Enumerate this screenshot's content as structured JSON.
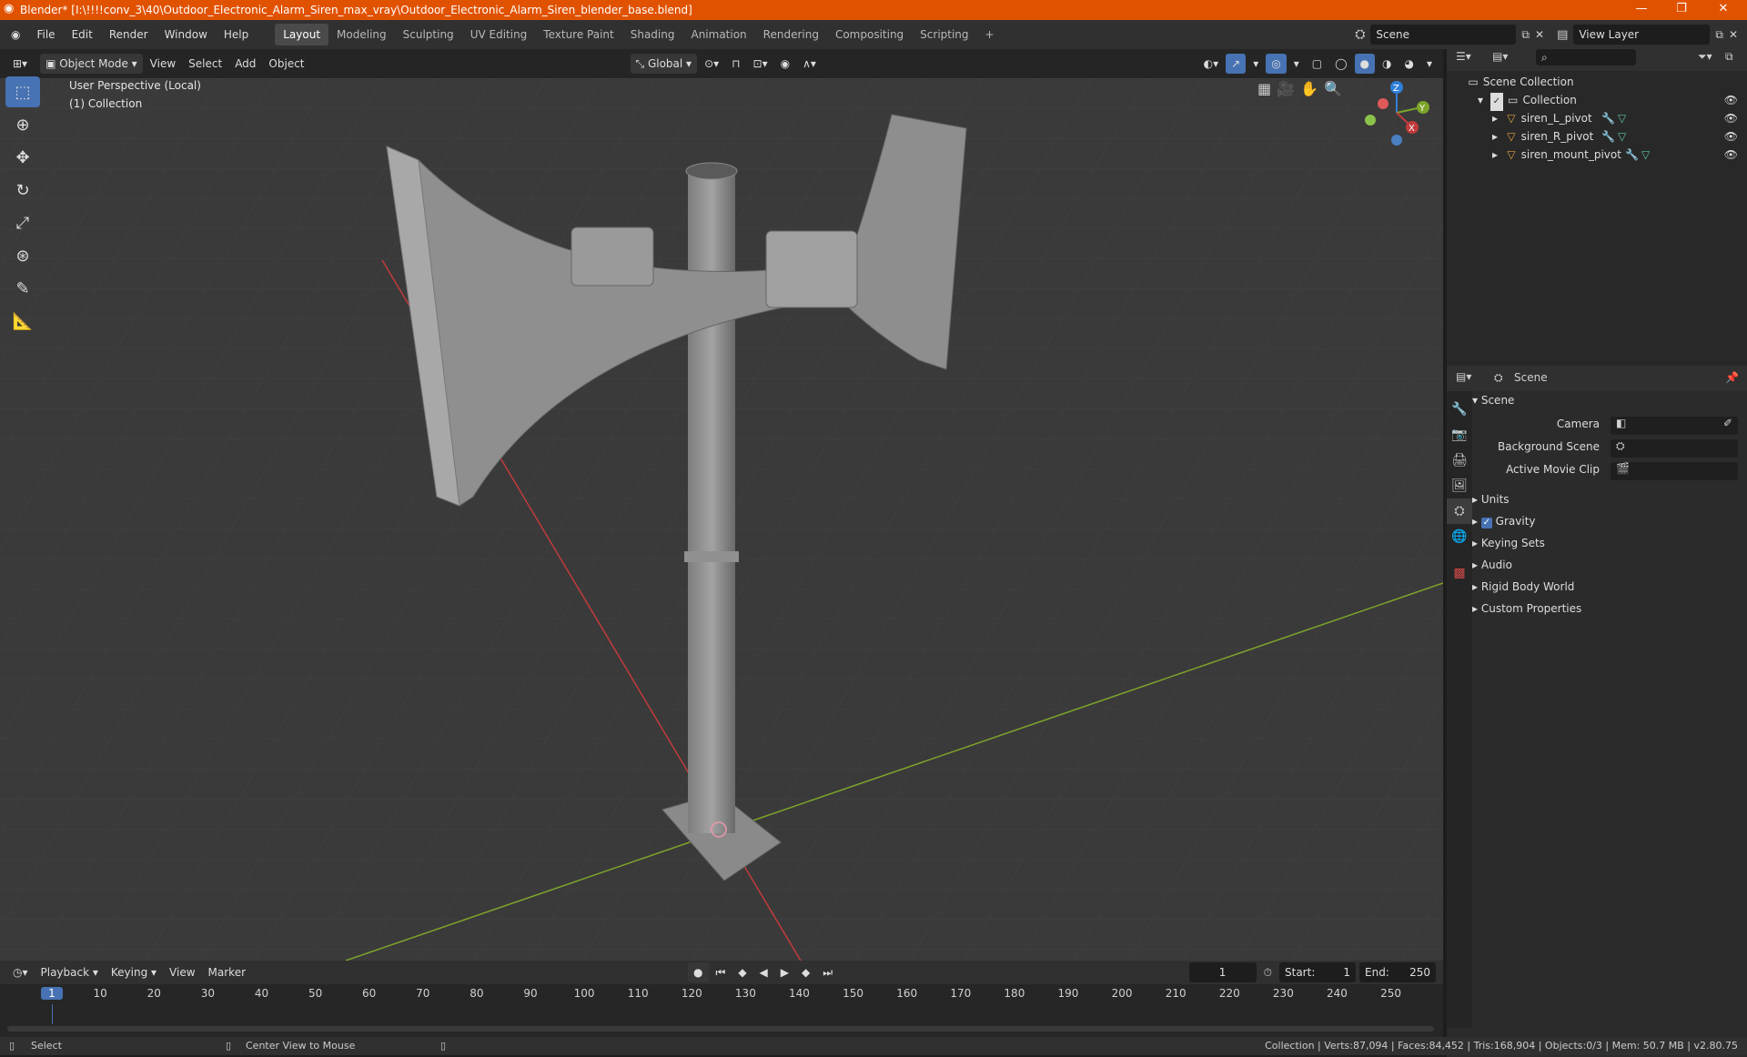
{
  "window": {
    "title": "Blender* [I:\\!!!!conv_3\\40\\Outdoor_Electronic_Alarm_Siren_max_vray\\Outdoor_Electronic_Alarm_Siren_blender_base.blend]",
    "controls": [
      "minimize-icon",
      "maximize-icon",
      "close-icon"
    ]
  },
  "menus": [
    "File",
    "Edit",
    "Render",
    "Window",
    "Help"
  ],
  "workspaces": [
    "Layout",
    "Modeling",
    "Sculpting",
    "UV Editing",
    "Texture Paint",
    "Shading",
    "Animation",
    "Rendering",
    "Compositing",
    "Scripting"
  ],
  "active_workspace": "Layout",
  "scene_selector": "Scene",
  "view_layer_selector": "View Layer",
  "viewport_header": {
    "mode": "Object Mode",
    "menus": [
      "View",
      "Select",
      "Add",
      "Object"
    ],
    "orientation": "Global"
  },
  "viewport_overlay": {
    "perspective": "User Perspective (Local)",
    "collection": "(1) Collection"
  },
  "gizmo_axes": {
    "x": "X",
    "y": "Y",
    "z": "Z"
  },
  "outliner": {
    "root": "Scene Collection",
    "collection": "Collection",
    "objects": [
      "siren_L_pivot",
      "siren_R_pivot",
      "siren_mount_pivot"
    ]
  },
  "properties": {
    "header": "Scene",
    "panel": "Scene",
    "camera_label": "Camera",
    "background_scene_label": "Background Scene",
    "active_movie_clip_label": "Active Movie Clip",
    "sections": [
      "Units",
      "Gravity",
      "Keying Sets",
      "Audio",
      "Rigid Body World",
      "Custom Properties"
    ],
    "gravity_checked": true
  },
  "timeline": {
    "menus": [
      "Playback",
      "Keying",
      "View",
      "Marker"
    ],
    "current_frame": "1",
    "start_label": "Start:",
    "start": "1",
    "end_label": "End:",
    "end": "250",
    "ruler": [
      "1",
      "10",
      "20",
      "30",
      "40",
      "50",
      "60",
      "70",
      "80",
      "90",
      "100",
      "110",
      "120",
      "130",
      "140",
      "150",
      "160",
      "170",
      "180",
      "190",
      "200",
      "210",
      "220",
      "230",
      "240",
      "250"
    ]
  },
  "statusbar": {
    "left": "Select",
    "middle": "Center View to Mouse",
    "right": "Collection | Verts:87,094 | Faces:84,452 | Tris:168,904 | Objects:0/3 | Mem: 50.7 MB | v2.80.75"
  },
  "colors": {
    "accent": "#4772b3",
    "title_bar": "#e15200",
    "x_axis": "#c23b3b",
    "y_axis": "#7da52a",
    "z_axis": "#2f7fd8"
  }
}
